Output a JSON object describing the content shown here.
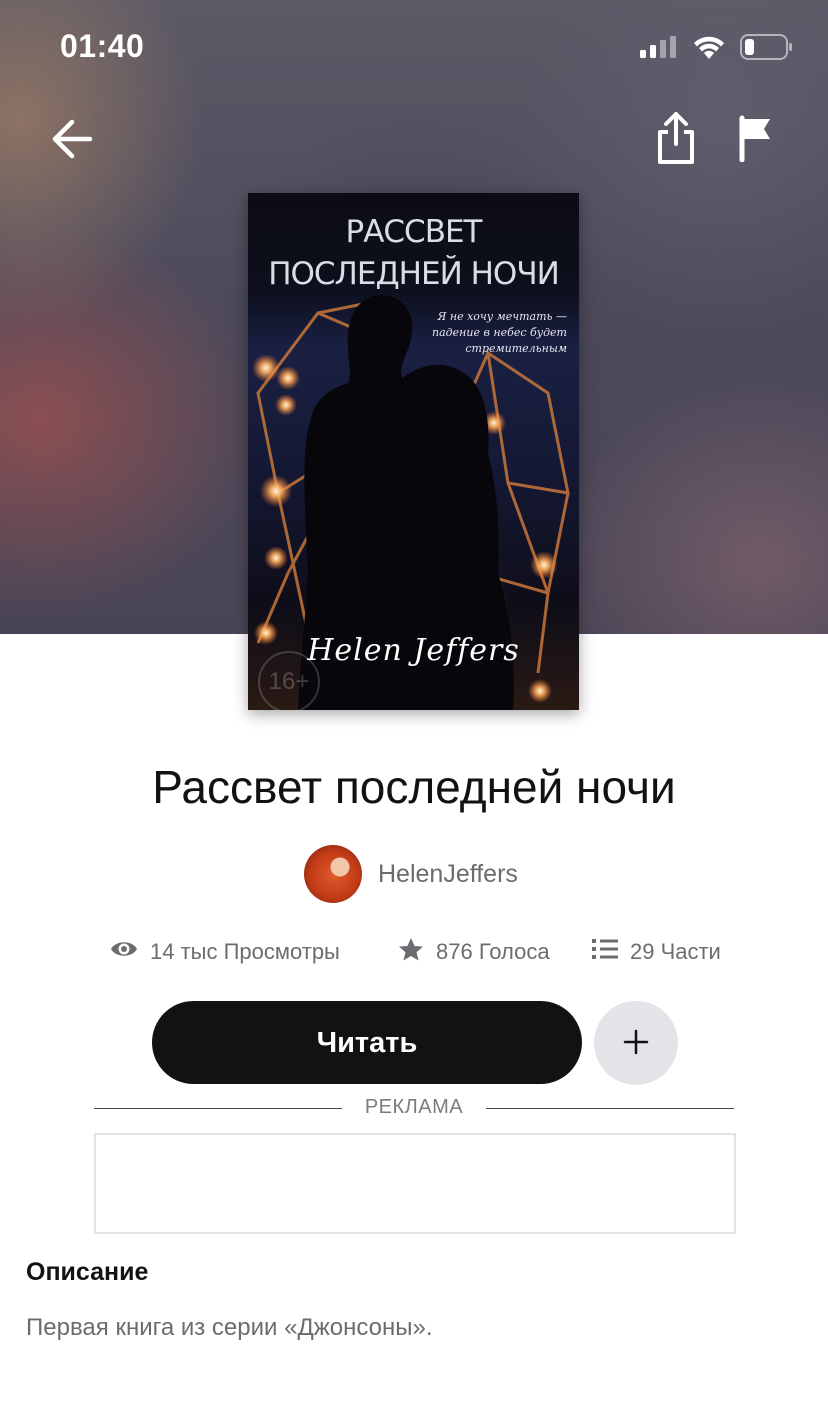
{
  "status_bar": {
    "time": "01:40"
  },
  "nav": {
    "back_icon": "arrow-left-icon",
    "share_icon": "share-icon",
    "flag_icon": "flag-icon"
  },
  "cover": {
    "title": "Рассвет последней ночи",
    "tagline": "Я не хочу мечтать — падение в небес будет стремительным",
    "author": "Helen Jeffers",
    "age_rating": "16+"
  },
  "book": {
    "title": "Рассвет последней ночи",
    "author_name": "HelenJeffers"
  },
  "stats": {
    "views": "14 тыс Просмотры",
    "votes": "876 Голоса",
    "parts": "29 Части"
  },
  "actions": {
    "read_label": "Читать",
    "add_icon": "plus-icon"
  },
  "ad": {
    "label": "РЕКЛАМА"
  },
  "description": {
    "heading": "Описание",
    "text": "Первая книга из серии «Джонсоны»."
  },
  "colors": {
    "primary_button": "#121212",
    "secondary_button": "#e4e3e8",
    "muted_text": "#6c6c70"
  }
}
